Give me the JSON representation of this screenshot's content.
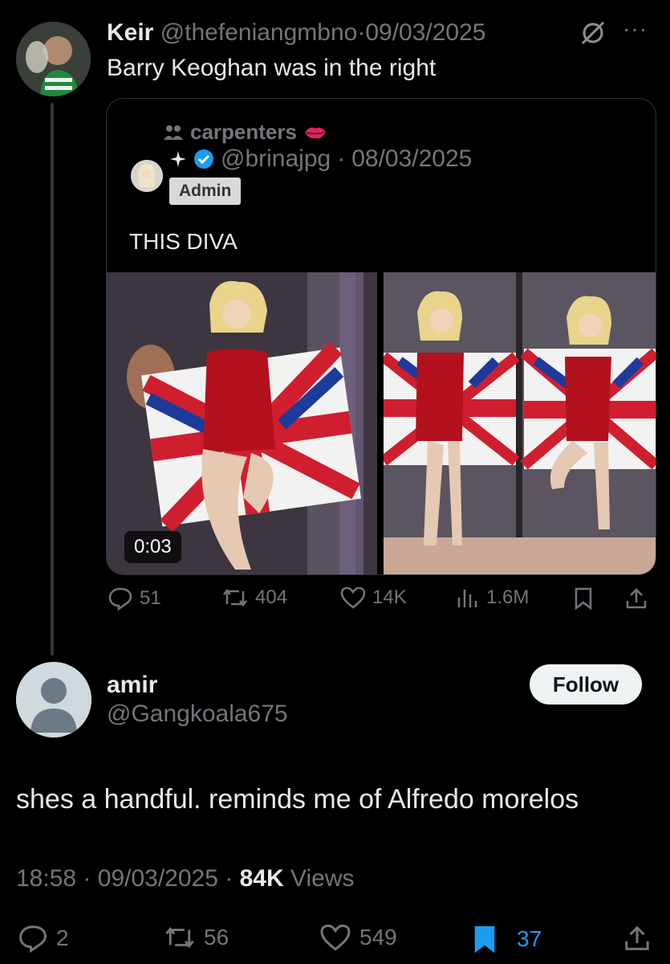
{
  "parent_tweet": {
    "name": "Keir",
    "handle": "@thefeniangmbno",
    "sep": "·",
    "date": "09/03/2025",
    "more": "···",
    "text": "Barry Keoghan was in the right"
  },
  "quoted_tweet": {
    "community": "carpenters",
    "handle": "@brinajpg",
    "sep": "·",
    "date": "08/03/2025",
    "badge": "Admin",
    "text": "THIS DIVA",
    "video_duration": "0:03",
    "stats": {
      "replies": "51",
      "reposts": "404",
      "likes": "14K",
      "views": "1.6M"
    }
  },
  "reply": {
    "name": "amir",
    "handle": "@Gangkoala675",
    "follow_label": "Follow",
    "text": "shes a handful. reminds me of Alfredo morelos",
    "time": "18:58",
    "sep": "·",
    "date": "09/03/2025",
    "views_count": "84K",
    "views_label": "Views",
    "stats": {
      "replies": "2",
      "reposts": "56",
      "likes": "549",
      "bookmarks": "37"
    }
  },
  "colors": {
    "background": "#000000",
    "text": "#e7e9ea",
    "muted": "#71767b",
    "verified": "#1d9bf0",
    "bookmark_active": "#1d9bf0",
    "lips": "#e0245e"
  }
}
